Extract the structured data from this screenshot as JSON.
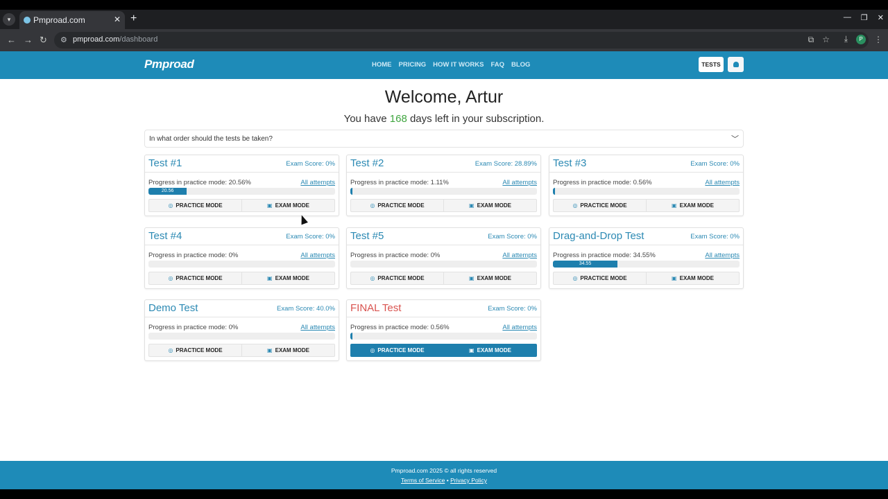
{
  "browser": {
    "tab_title": "Pmproad.com",
    "url_host": "pmproad.com",
    "url_path": "/dashboard",
    "profile_initial": "P"
  },
  "site": {
    "logo": "Pmproad",
    "nav": [
      "HOME",
      "PRICING",
      "HOW IT WORKS",
      "FAQ",
      "BLOG"
    ],
    "tests_button": "TESTS"
  },
  "welcome": {
    "title": "Welcome, Artur",
    "prefix": "You have",
    "days": "168",
    "suffix": "days left in your subscription."
  },
  "accordion": {
    "question": "In what order should the tests be taken?"
  },
  "labels": {
    "progress": "Progress in practice mode:",
    "attempts": "All attempts",
    "practice": "PRACTICE MODE",
    "exam": "EXAM MODE"
  },
  "tests": [
    {
      "title": "Test #1",
      "score": "Exam Score: 0%",
      "progress_text": "Progress in practice mode: 20.56%",
      "progress": 20.56,
      "bar_label": "20.56"
    },
    {
      "title": "Test #2",
      "score": "Exam Score: 28.89%",
      "progress_text": "Progress in practice mode: 1.11%",
      "progress": 1.11,
      "bar_label": ""
    },
    {
      "title": "Test #3",
      "score": "Exam Score: 0%",
      "progress_text": "Progress in practice mode: 0.56%",
      "progress": 0.56,
      "bar_label": ""
    },
    {
      "title": "Test #4",
      "score": "Exam Score: 0%",
      "progress_text": "Progress in practice mode: 0%",
      "progress": 0,
      "bar_label": ""
    },
    {
      "title": "Test #5",
      "score": "Exam Score: 0%",
      "progress_text": "Progress in practice mode: 0%",
      "progress": 0,
      "bar_label": ""
    },
    {
      "title": "Drag-and-Drop Test",
      "score": "Exam Score: 0%",
      "progress_text": "Progress in practice mode: 34.55%",
      "progress": 34.55,
      "bar_label": "34.55"
    },
    {
      "title": "Demo Test",
      "score": "Exam Score: 40.0%",
      "progress_text": "Progress in practice mode: 0%",
      "progress": 0,
      "bar_label": ""
    },
    {
      "title": "FINAL Test",
      "score": "Exam Score: 0%",
      "progress_text": "Progress in practice mode: 0.56%",
      "progress": 0.56,
      "bar_label": "",
      "highlight": true
    }
  ],
  "footer": {
    "copyright": "Pmproad.com 2025 © all rights reserved",
    "terms": "Terms of Service",
    "separator": "•",
    "privacy": "Privacy Policy"
  },
  "colors": {
    "brand": "#1e8bb8",
    "accent_text": "#2b89b3",
    "days_green": "#3fa53f",
    "final_red": "#d9534f"
  }
}
